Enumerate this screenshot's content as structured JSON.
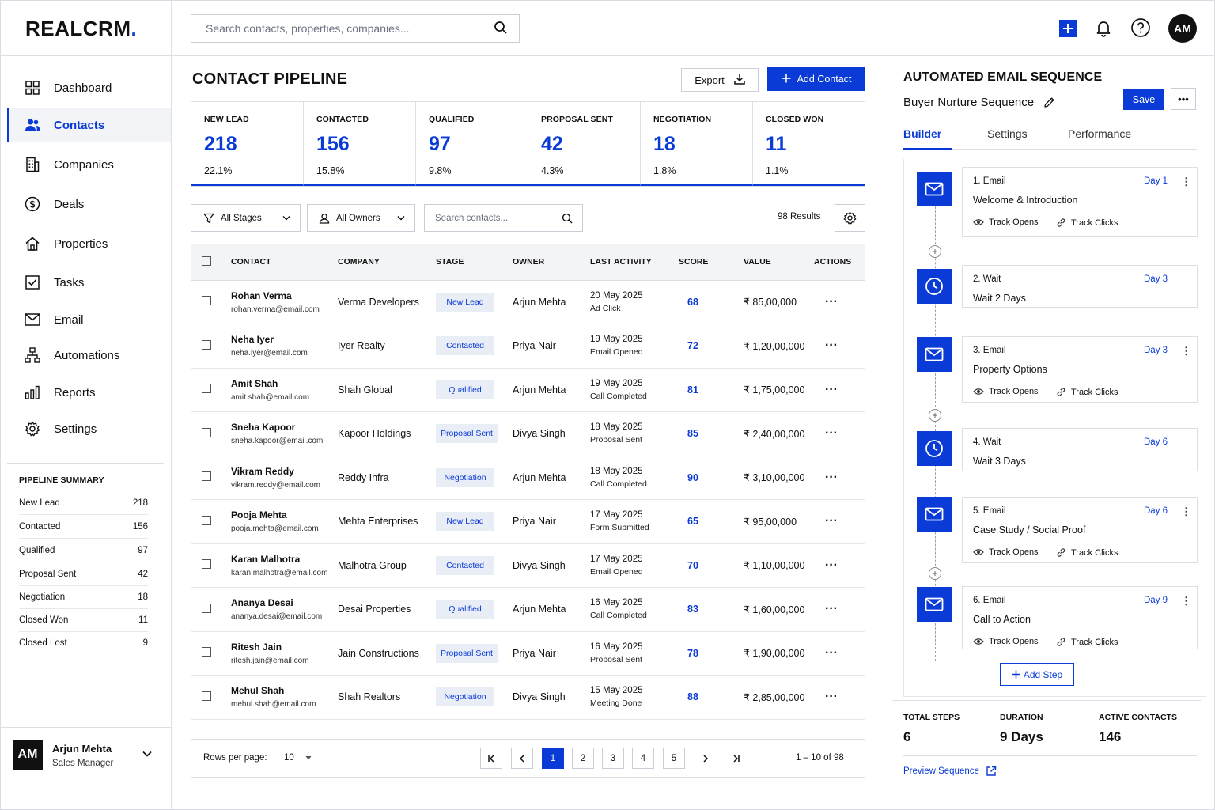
{
  "app": {
    "logo": "REALCRM",
    "logo_dot": "."
  },
  "topbar": {
    "search_placeholder": "Search contacts, properties, companies...",
    "user_initials": "AM"
  },
  "sidebar": {
    "items": [
      {
        "label": "Dashboard",
        "icon": "grid-icon"
      },
      {
        "label": "Contacts",
        "icon": "users-icon",
        "active": true
      },
      {
        "label": "Companies",
        "icon": "building-icon"
      },
      {
        "label": "Deals",
        "icon": "dollar-icon"
      },
      {
        "label": "Properties",
        "icon": "home-icon"
      },
      {
        "label": "Tasks",
        "icon": "checkbox-icon"
      },
      {
        "label": "Email",
        "icon": "mail-icon"
      },
      {
        "label": "Automations",
        "icon": "flow-icon"
      },
      {
        "label": "Reports",
        "icon": "bar-chart-icon"
      },
      {
        "label": "Settings",
        "icon": "gear-icon"
      }
    ],
    "pipeline_summary": {
      "title": "PIPELINE SUMMARY",
      "rows": [
        {
          "label": "New Lead",
          "value": "218"
        },
        {
          "label": "Contacted",
          "value": "156"
        },
        {
          "label": "Qualified",
          "value": "97"
        },
        {
          "label": "Proposal Sent",
          "value": "42"
        },
        {
          "label": "Negotiation",
          "value": "18"
        },
        {
          "label": "Closed Won",
          "value": "11"
        },
        {
          "label": "Closed Lost",
          "value": "9"
        }
      ]
    },
    "user": {
      "initials": "AM",
      "name": "Arjun Mehta",
      "role": "Sales Manager"
    }
  },
  "main": {
    "title": "CONTACT PIPELINE",
    "export_label": "Export",
    "add_contact_label": "Add Contact",
    "stages": [
      {
        "label": "NEW LEAD",
        "count": "218",
        "pct": "22.1%"
      },
      {
        "label": "CONTACTED",
        "count": "156",
        "pct": "15.8%"
      },
      {
        "label": "QUALIFIED",
        "count": "97",
        "pct": "9.8%"
      },
      {
        "label": "PROPOSAL SENT",
        "count": "42",
        "pct": "4.3%"
      },
      {
        "label": "NEGOTIATION",
        "count": "18",
        "pct": "1.8%"
      },
      {
        "label": "CLOSED WON",
        "count": "11",
        "pct": "1.1%"
      }
    ],
    "filters": {
      "stages": "All Stages",
      "owners": "All Owners",
      "search_placeholder": "Search contacts...",
      "results": "98 Results"
    },
    "table": {
      "headers": [
        "CONTACT",
        "COMPANY",
        "STAGE",
        "OWNER",
        "LAST ACTIVITY",
        "SCORE",
        "VALUE",
        "ACTIONS"
      ],
      "rows": [
        {
          "name": "Rohan Verma",
          "email": "rohan.verma@email.com",
          "company": "Verma Developers",
          "stage": "New Lead",
          "owner": "Arjun Mehta",
          "date": "20 May 2025",
          "activity": "Ad Click",
          "score": "68",
          "value": "₹ 85,00,000"
        },
        {
          "name": "Neha Iyer",
          "email": "neha.iyer@email.com",
          "company": "Iyer Realty",
          "stage": "Contacted",
          "owner": "Priya Nair",
          "date": "19 May 2025",
          "activity": "Email Opened",
          "score": "72",
          "value": "₹ 1,20,00,000"
        },
        {
          "name": "Amit Shah",
          "email": "amit.shah@email.com",
          "company": "Shah Global",
          "stage": "Qualified",
          "owner": "Arjun Mehta",
          "date": "19 May 2025",
          "activity": "Call Completed",
          "score": "81",
          "value": "₹ 1,75,00,000"
        },
        {
          "name": "Sneha Kapoor",
          "email": "sneha.kapoor@email.com",
          "company": "Kapoor Holdings",
          "stage": "Proposal Sent",
          "owner": "Divya Singh",
          "date": "18 May 2025",
          "activity": "Proposal Sent",
          "score": "85",
          "value": "₹ 2,40,00,000"
        },
        {
          "name": "Vikram Reddy",
          "email": "vikram.reddy@email.com",
          "company": "Reddy Infra",
          "stage": "Negotiation",
          "owner": "Arjun Mehta",
          "date": "18 May 2025",
          "activity": "Call Completed",
          "score": "90",
          "value": "₹ 3,10,00,000"
        },
        {
          "name": "Pooja Mehta",
          "email": "pooja.mehta@email.com",
          "company": "Mehta Enterprises",
          "stage": "New Lead",
          "owner": "Priya Nair",
          "date": "17 May 2025",
          "activity": "Form Submitted",
          "score": "65",
          "value": "₹ 95,00,000"
        },
        {
          "name": "Karan Malhotra",
          "email": "karan.malhotra@email.com",
          "company": "Malhotra Group",
          "stage": "Contacted",
          "owner": "Divya Singh",
          "date": "17 May 2025",
          "activity": "Email Opened",
          "score": "70",
          "value": "₹ 1,10,00,000"
        },
        {
          "name": "Ananya Desai",
          "email": "ananya.desai@email.com",
          "company": "Desai Properties",
          "stage": "Qualified",
          "owner": "Arjun Mehta",
          "date": "16 May 2025",
          "activity": "Call Completed",
          "score": "83",
          "value": "₹ 1,60,00,000"
        },
        {
          "name": "Ritesh Jain",
          "email": "ritesh.jain@email.com",
          "company": "Jain Constructions",
          "stage": "Proposal Sent",
          "owner": "Priya Nair",
          "date": "16 May 2025",
          "activity": "Proposal Sent",
          "score": "78",
          "value": "₹ 1,90,00,000"
        },
        {
          "name": "Mehul Shah",
          "email": "mehul.shah@email.com",
          "company": "Shah Realtors",
          "stage": "Negotiation",
          "owner": "Divya Singh",
          "date": "15 May 2025",
          "activity": "Meeting Done",
          "score": "88",
          "value": "₹ 2,85,00,000"
        }
      ]
    },
    "pagination": {
      "rows_label": "Rows per page:",
      "rows_value": "10",
      "pages": [
        "1",
        "2",
        "3",
        "4",
        "5"
      ],
      "current_page": "1",
      "range": "1 – 10 of 98"
    }
  },
  "right_panel": {
    "title": "AUTOMATED EMAIL SEQUENCE",
    "sequence_name": "Buyer Nurture Sequence",
    "save_label": "Save",
    "tabs": [
      "Builder",
      "Settings",
      "Performance"
    ],
    "steps": [
      {
        "type": "email",
        "head": "1. Email",
        "day": "Day 1",
        "sub": "Welcome & Introduction",
        "track_opens": "Track Opens",
        "track_clicks": "Track Clicks"
      },
      {
        "type": "wait",
        "head": "2. Wait",
        "day": "Day 3",
        "sub": "Wait 2 Days"
      },
      {
        "type": "email",
        "head": "3. Email",
        "day": "Day 3",
        "sub": "Property Options",
        "track_opens": "Track Opens",
        "track_clicks": "Track Clicks"
      },
      {
        "type": "wait",
        "head": "4. Wait",
        "day": "Day 6",
        "sub": "Wait 3 Days"
      },
      {
        "type": "email",
        "head": "5. Email",
        "day": "Day 6",
        "sub": "Case Study / Social Proof",
        "track_opens": "Track Opens",
        "track_clicks": "Track Clicks"
      },
      {
        "type": "email",
        "head": "6. Email",
        "day": "Day 9",
        "sub": "Call to Action",
        "track_opens": "Track Opens",
        "track_clicks": "Track Clicks"
      }
    ],
    "add_step_label": "Add Step",
    "stats": [
      {
        "label": "TOTAL STEPS",
        "value": "6"
      },
      {
        "label": "DURATION",
        "value": "9 Days"
      },
      {
        "label": "ACTIVE CONTACTS",
        "value": "146"
      }
    ],
    "preview_label": "Preview Sequence"
  },
  "colors": {
    "accent": "#0b3bd6",
    "badge_bg": "#e8edf6",
    "border": "#dcdfe4"
  }
}
